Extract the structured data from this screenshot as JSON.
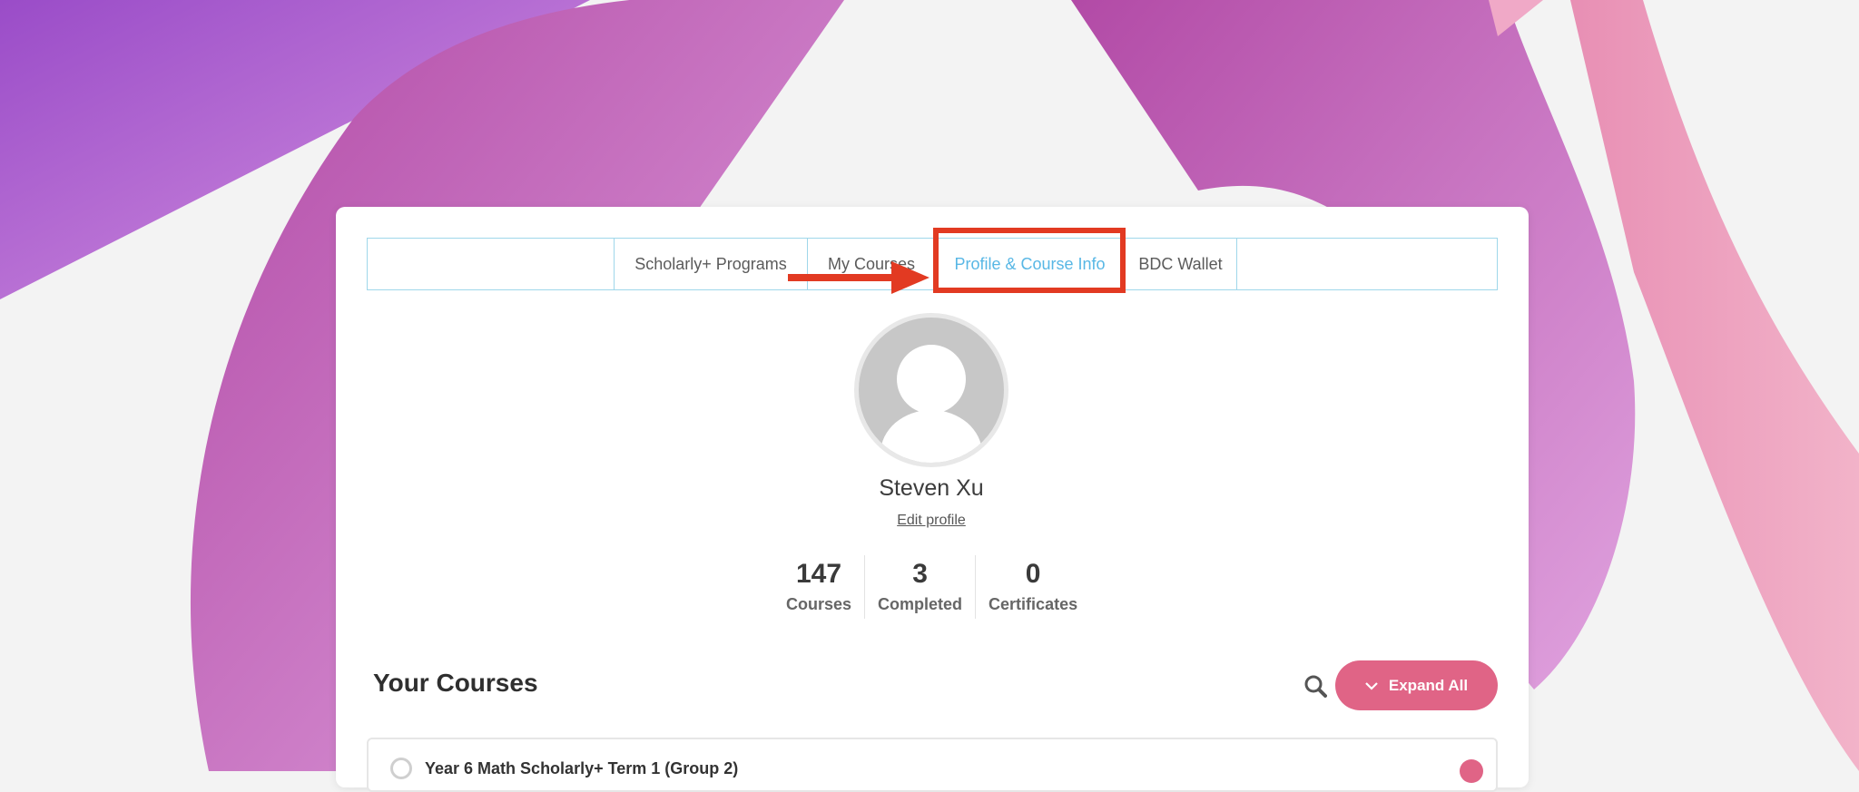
{
  "tabs": {
    "programs": "Scholarly+ Programs",
    "my_courses": "My Courses",
    "profile": "Profile & Course Info",
    "wallet": "BDC Wallet"
  },
  "profile": {
    "name": "Steven Xu",
    "edit_label": "Edit profile"
  },
  "stats": [
    {
      "value": "147",
      "label": "Courses"
    },
    {
      "value": "3",
      "label": "Completed"
    },
    {
      "value": "0",
      "label": "Certificates"
    }
  ],
  "courses": {
    "heading": "Your Courses",
    "expand_label": "Expand All",
    "first_course": "Year 6 Math Scholarly+ Term 1 (Group 2)"
  },
  "colors": {
    "accent": "#e06486",
    "tab_active": "#58b7e5",
    "highlight": "#e23a22"
  }
}
